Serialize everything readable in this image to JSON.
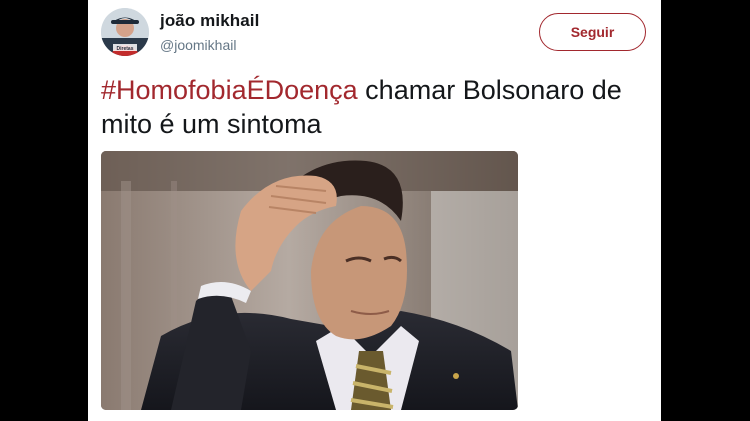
{
  "tweet": {
    "display_name": "joão mikhail",
    "handle": "@joomikhail",
    "follow_label": "Seguir",
    "hashtag": "#HomofobiaÉDoença",
    "text_rest": " chamar Bolsonaro de mito é um sintoma",
    "avatar_caption": "Diretas"
  },
  "colors": {
    "accent": "#a2282e",
    "text": "#14171a",
    "secondary": "#657786",
    "frame": "#000000"
  }
}
